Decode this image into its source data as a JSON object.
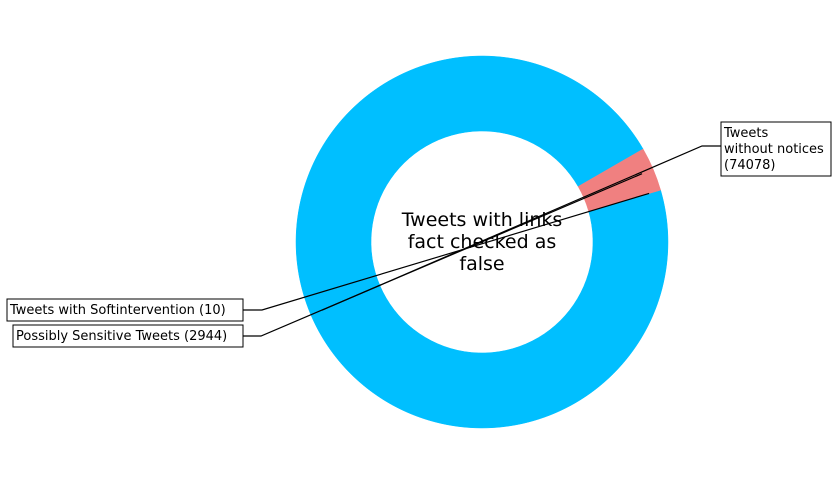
{
  "chart_data": {
    "type": "pie",
    "variant": "donut",
    "center_label": [
      "Tweets with links",
      "fact checked as",
      "false"
    ],
    "slices": [
      {
        "label": "Tweets\nwithout notices\n(74078)",
        "value": 74078,
        "color": "#00BFFF"
      },
      {
        "label": "Tweets with Softintervention (10)",
        "value": 10,
        "color": "#F08080"
      },
      {
        "label": "Possibly Sensitive Tweets (2944)",
        "value": 2944,
        "color": "#F08080"
      }
    ],
    "legend": "none",
    "grid": false
  }
}
